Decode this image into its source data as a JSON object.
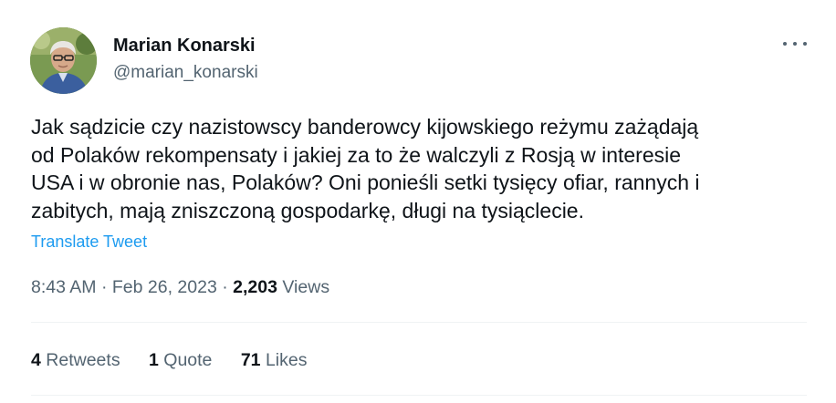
{
  "author": {
    "name": "Marian Konarski",
    "handle": "@marian_konarski"
  },
  "tweet": {
    "text": "Jak sądzicie czy nazistowscy banderowcy kijowskiego reżymu zażądają\nod Polaków rekompensaty i jakiej za to że walczyli z Rosją w interesie\nUSA i w obronie nas, Polaków? Oni ponieśli setki tysięcy ofiar, rannych i\nzabitych, mają zniszczoną gospodarkę, długi na tysiąclecie.",
    "translate_label": "Translate Tweet",
    "time": "8:43 AM",
    "date": "Feb 26, 2023",
    "views_count": "2,203",
    "views_label": "Views"
  },
  "stats": {
    "retweets_count": "4",
    "retweets_label": "Retweets",
    "quotes_count": "1",
    "quotes_label": "Quote",
    "likes_count": "71",
    "likes_label": "Likes"
  },
  "colors": {
    "link": "#1d9bf0",
    "secondary_text": "#536471",
    "primary_text": "#0f1419",
    "divider": "#eff3f4"
  },
  "icons": {
    "more": "more-options-icon"
  }
}
